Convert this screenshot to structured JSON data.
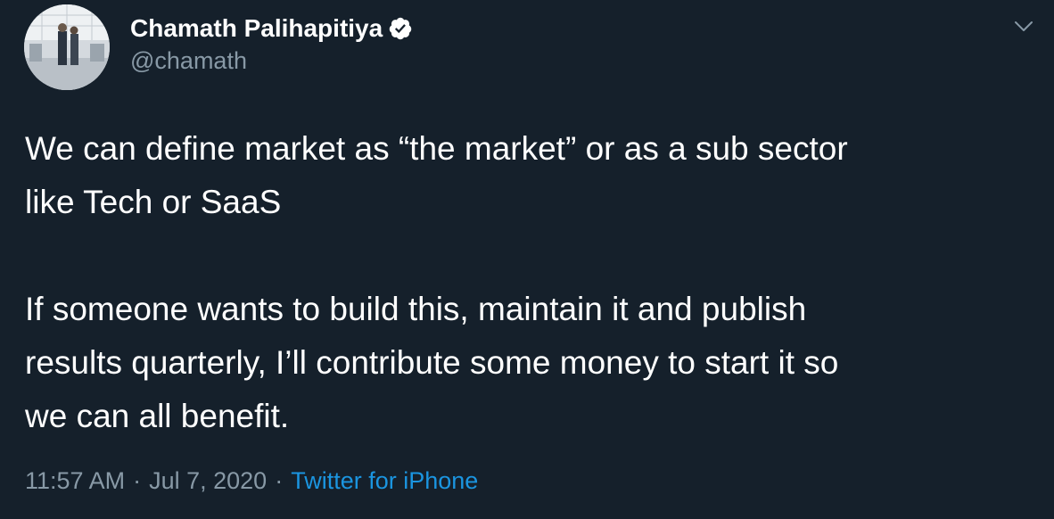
{
  "author": {
    "display_name": "Chamath Palihapitiya",
    "handle": "@chamath",
    "verified": true
  },
  "tweet": {
    "paragraphs": [
      [
        "We can define market as “the market” or as a sub sector",
        "like Tech or SaaS"
      ],
      [
        "If someone wants to build this, maintain it and publish",
        "results quarterly, I’ll contribute some money to start it so",
        "we can all benefit."
      ]
    ]
  },
  "meta": {
    "time": "11:57 AM",
    "separator": "·",
    "date": "Jul 7, 2020",
    "source": "Twitter for iPhone"
  },
  "icons": {
    "verified": "verified-badge-icon",
    "menu": "chevron-down-icon"
  },
  "colors": {
    "background": "#15202b",
    "text": "#ffffff",
    "secondary": "#8899a6",
    "link": "#1b95e0"
  }
}
